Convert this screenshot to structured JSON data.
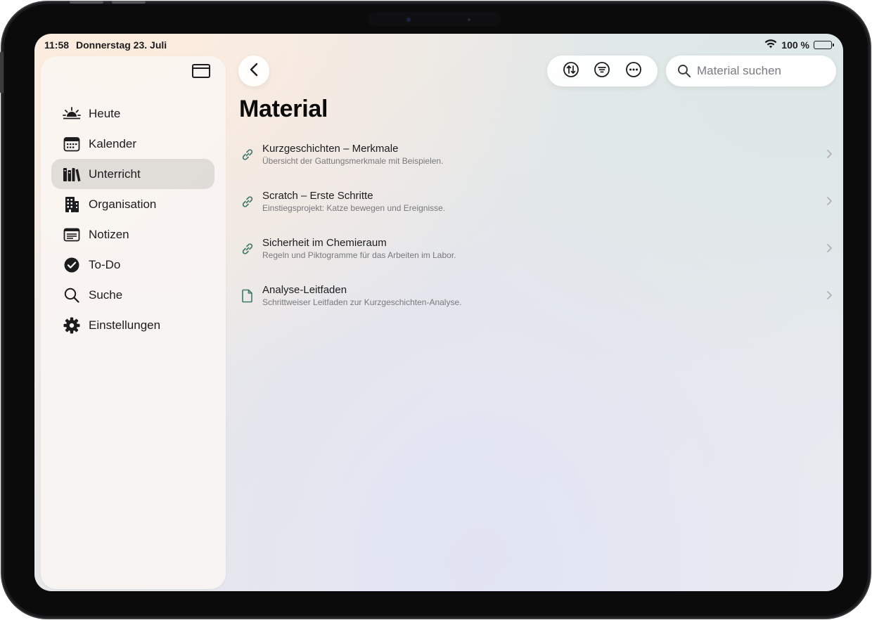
{
  "status": {
    "time": "11:58",
    "date": "Donnerstag 23. Juli",
    "battery": "100 %"
  },
  "sidebar": {
    "items": [
      {
        "label": "Heute",
        "icon": "sunrise-icon"
      },
      {
        "label": "Kalender",
        "icon": "calendar-icon"
      },
      {
        "label": "Unterricht",
        "icon": "books-icon",
        "active": true
      },
      {
        "label": "Organisation",
        "icon": "building-icon"
      },
      {
        "label": "Notizen",
        "icon": "notes-icon"
      },
      {
        "label": "To-Do",
        "icon": "checkmark-circle-icon"
      },
      {
        "label": "Suche",
        "icon": "magnifier-icon"
      },
      {
        "label": "Einstellungen",
        "icon": "gear-icon"
      }
    ]
  },
  "search": {
    "placeholder": "Material suchen"
  },
  "page": {
    "title": "Material"
  },
  "materials": [
    {
      "title": "Kurzgeschichten – Merkmale",
      "subtitle": "Übersicht der Gattungsmerkmale mit Beispielen.",
      "icon": "link-icon"
    },
    {
      "title": "Scratch – Erste Schritte",
      "subtitle": "Einstiegsprojekt: Katze bewegen und Ereignisse.",
      "icon": "link-icon"
    },
    {
      "title": "Sicherheit im Chemieraum",
      "subtitle": "Regeln und Piktogramme für das Arbeiten im Labor.",
      "icon": "link-icon"
    },
    {
      "title": "Analyse-Leitfaden",
      "subtitle": "Schrittweiser Leitfaden zur Kurzgeschichten-Analyse.",
      "icon": "document-icon"
    }
  ],
  "colors": {
    "accent_icon": "#3f7a6a",
    "text_primary": "#1c1c1e",
    "text_secondary": "#78787d"
  }
}
